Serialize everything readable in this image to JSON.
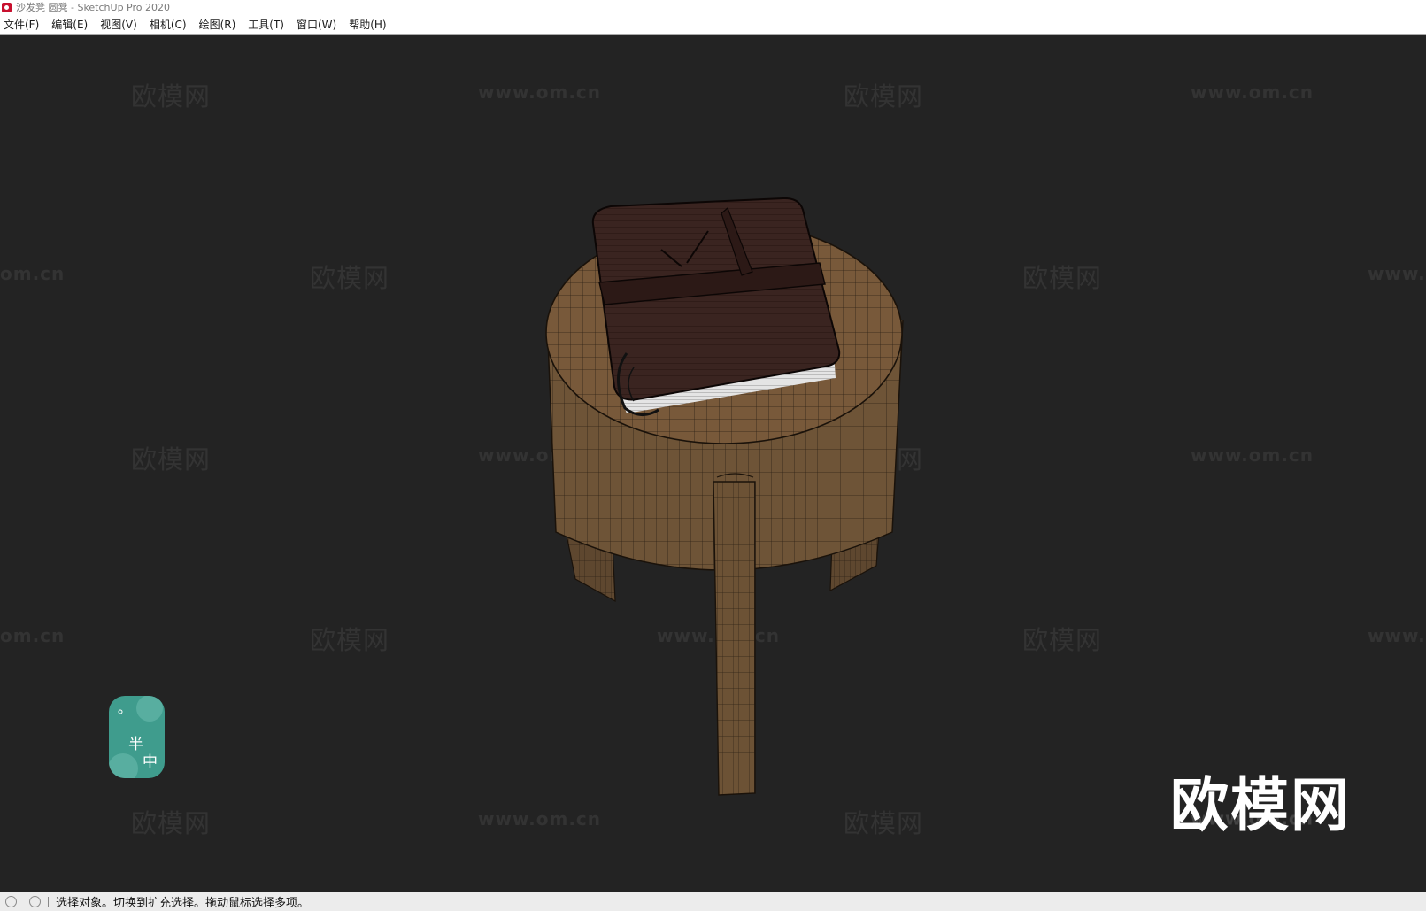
{
  "window": {
    "title": "沙发凳 圆凳 - SketchUp Pro 2020"
  },
  "menubar": {
    "items": [
      "文件(F)",
      "编辑(E)",
      "视图(V)",
      "相机(C)",
      "绘图(R)",
      "工具(T)",
      "窗口(W)",
      "帮助(H)"
    ]
  },
  "watermarks": {
    "logo_text": "欧模网",
    "url_text": "www.om.cn",
    "url_partial_left": "om.cn",
    "url_partial_right": "www."
  },
  "badge": {
    "text_top": "半",
    "text_bottom": "中",
    "accent": "#3f9c8d"
  },
  "statusbar": {
    "message": "选择对象。切换到扩充选择。拖动鼠标选择多项。"
  },
  "icons": {
    "app": "sketchup-app-icon",
    "status_left": "geolocation-icon",
    "status_right": "info-icon"
  },
  "colors": {
    "viewport_bg": "#232323",
    "wood": "#6e5437",
    "book_cover": "#3a2420"
  }
}
